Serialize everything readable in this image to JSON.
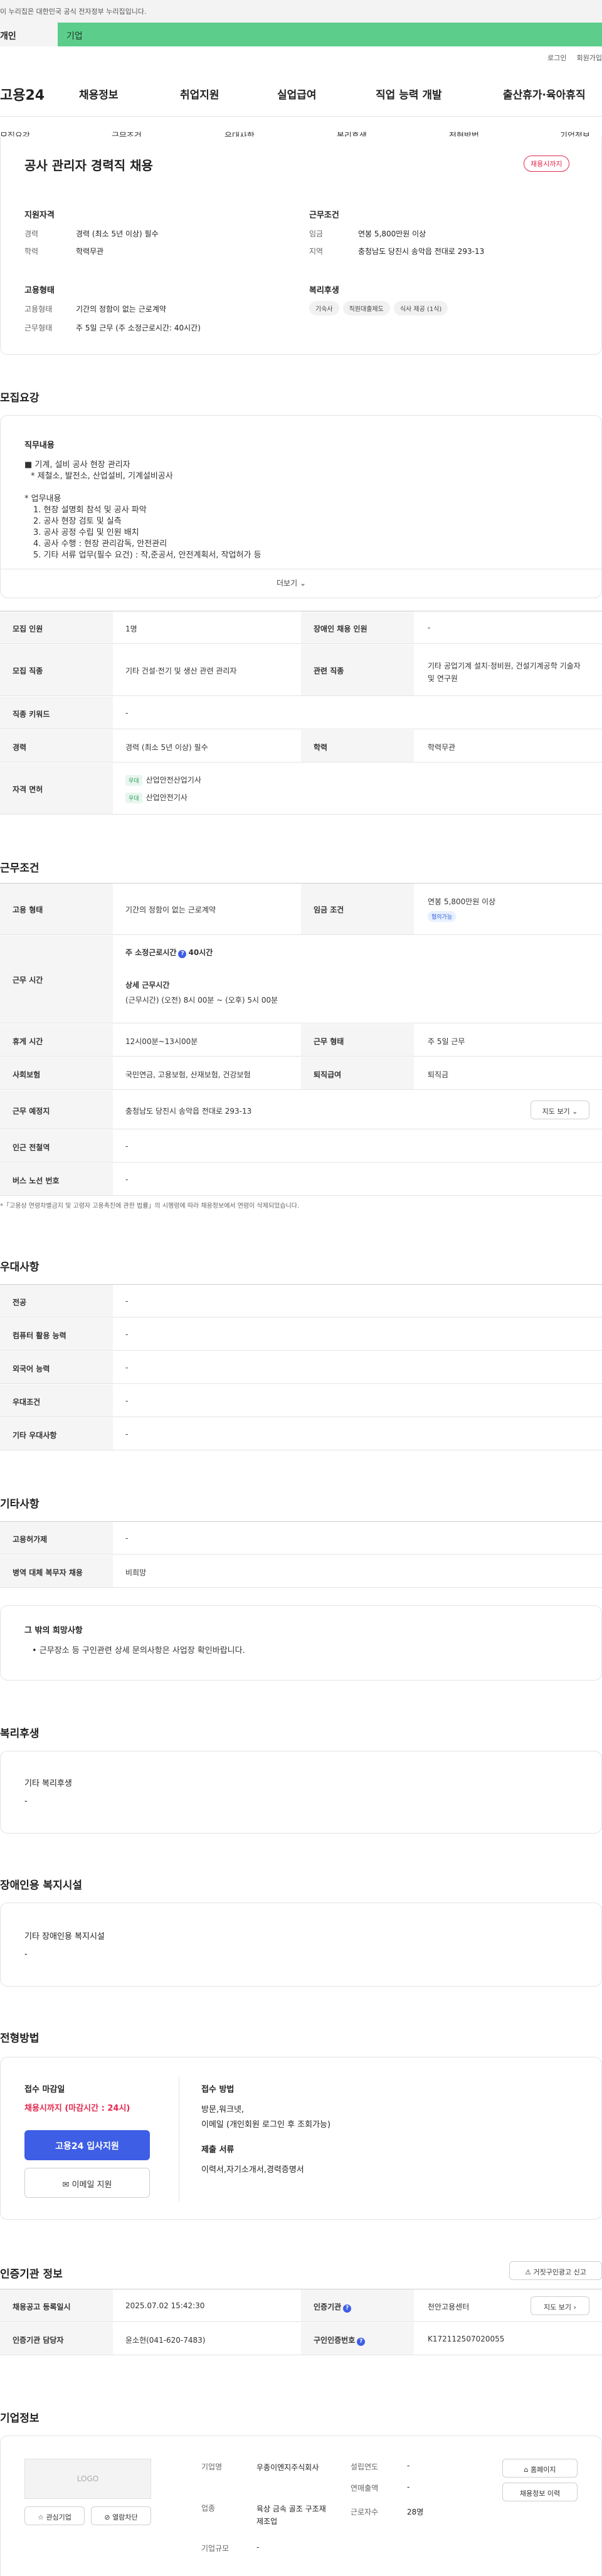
{
  "notice": "이 누리집은 대한민국 공식 전자정부 누리집입니다.",
  "tabs": {
    "personal": "개인",
    "company": "기업"
  },
  "util": {
    "login": "로그인",
    "join": "회원가입"
  },
  "brand": "고용24",
  "nav": [
    "채용정보",
    "취업지원",
    "실업급여",
    "직업 능력 개발",
    "출산휴가·육아휴직"
  ],
  "subnav": [
    "모집요강",
    "근무조건",
    "우대사항",
    "복리후생",
    "전형방법",
    "기업정보"
  ],
  "summary": {
    "title": "공사 관리자 경력직 채용",
    "badge": "채용시까지",
    "qual": {
      "title": "지원자격",
      "career_label": "경력",
      "career_value": "경력 (최소 5년 이상) 필수",
      "edu_label": "학력",
      "edu_value": "학력무관"
    },
    "work": {
      "title": "근무조건",
      "wage_label": "임금",
      "wage_value": "연봉 5,800만원 이상",
      "loc_label": "지역",
      "loc_value": "충청남도 당진시 송악읍 전대로 293-13"
    },
    "employ": {
      "title": "고용형태",
      "type_label": "고용형태",
      "type_value": "기간의 정함이 없는 근로계약",
      "shift_label": "근무형태",
      "shift_value": "주 5일 근무 (주 소정근로시간: 40시간)"
    },
    "welfare": {
      "title": "복리후생",
      "chips": [
        "기숙사",
        "직원대출제도",
        "식사 제공 (1식)"
      ]
    }
  },
  "recruit": {
    "section": "모집요강",
    "duty_title": "직무내용",
    "lines": [
      "■ 기계, 설비 공사 현장 관리자",
      "* 제철소, 발전소, 산업설비, 기계설비공사",
      "",
      "* 업무내용",
      "  1. 현장 설명회 참석 및 공사 파악",
      "  2. 공사 현장 검토 및 실측",
      "  3. 공사 공정 수립 및 인원 배치",
      "  4. 공사 수행 : 현장 관리감독, 안전관리",
      "  5. 기타 서류 업무(필수 요건) : 작,준공서, 안전계획서, 작업허가 등"
    ],
    "more": "더보기",
    "rows": {
      "count_label": "모집 인원",
      "count_value": "1명",
      "disabled_label": "장애인 채용 인원",
      "disabled_value": "-",
      "job_label": "모집 직종",
      "job_value": "기타 건설·전기 및 생산 관련 관리자",
      "related_label": "관련 직종",
      "related_value": "기타 공업기계 설치·정비원, 건설기계공학 기술자 및 연구원",
      "keyword_label": "직종 키워드",
      "keyword_value": "-",
      "career_label": "경력",
      "career_value": "경력 (최소 5년 이상) 필수",
      "edu_label": "학력",
      "edu_value": "학력무관",
      "license_label": "자격 면허",
      "license_badge": "우대",
      "licenses": [
        "산업안전산업기사",
        "산업안전기사"
      ]
    }
  },
  "condition": {
    "section": "근무조건",
    "employ_label": "고용 형태",
    "employ_value": "기간의 정함이 없는 근로계약",
    "wage_label": "임금 조건",
    "wage_value": "연봉 5,800만원 이상",
    "wage_badge": "협의가능",
    "hours_label": "근무 시간",
    "hours_main": "주 소정근로시간",
    "hours_num": "40시간",
    "hours_detail_title": "상세 근무시간",
    "hours_detail": "(근무시간) (오전) 8시 00분 ~ (오후) 5시 00분",
    "break_label": "휴게 시간",
    "break_value": "12시00분~13시00분",
    "shift_label": "근무 형태",
    "shift_value": "주 5일 근무",
    "insurance_label": "사회보험",
    "insurance_value": "국민연금, 고용보험, 산재보험, 건강보험",
    "retire_label": "퇴직급여",
    "retire_value": "퇴직금",
    "place_label": "근무 예정지",
    "place_value": "충청남도 당진시 송악읍 전대로 293-13",
    "map_btn": "지도 보기",
    "station_label": "인근 전철역",
    "station_value": "-",
    "bus_label": "버스 노선 번호",
    "bus_value": "-",
    "footnote": "*「고용상 연령차별금지 및 고령자 고용촉진에 관한 법률」의 시행령에 따라 채용정보에서 연령이 삭제되었습니다."
  },
  "pref": {
    "section": "우대사항",
    "rows": [
      [
        "전공",
        "-"
      ],
      [
        "컴퓨터 활용 능력",
        "-"
      ],
      [
        "외국어 능력",
        "-"
      ],
      [
        "우대조건",
        "-"
      ],
      [
        "기타 우대사항",
        "-"
      ]
    ]
  },
  "etc": {
    "section": "기타사항",
    "rows": [
      [
        "고용허가제",
        "-"
      ],
      [
        "병역 대체 복무자 채용",
        "비희망"
      ]
    ],
    "box_title": "그 밖의 희망사항",
    "box_text": "• 근무장소 등 구인관련 상세 문의사항은 사업장 확인바랍니다."
  },
  "benefit": {
    "section": "복리후생",
    "title": "기타 복리후생",
    "value": "-"
  },
  "disabled": {
    "section": "장애인용 복지시설",
    "title": "기타 장애인용 복지시설",
    "value": "-"
  },
  "process": {
    "section": "전형방법",
    "deadline_label": "접수 마감일",
    "deadline_value": "채용시까지 (마감시간 : 24시)",
    "apply_btn": "고용24 입사지원",
    "email_btn": "이메일 지원",
    "method_label": "접수 방법",
    "method_value1": "방문,워크넷,",
    "method_value2": "이메일 (개인회원 로그인 후 조회가능)",
    "docs_label": "제출 서류",
    "docs_value": "이력서,자기소개서,경력증명서"
  },
  "cert": {
    "section": "인증기관 정보",
    "report_btn": "거짓구인광고 신고",
    "reg_label": "채용공고 등록일시",
    "reg_value": "2025.07.02 15:42:30",
    "agency_label": "인증기관",
    "agency_value": "천안고용센터",
    "map_btn": "지도 보기",
    "manager_label": "인증기관 담당자",
    "manager_value": "윤소현(041-620-7483)",
    "number_label": "구인인증번호",
    "number_value": "K172112507020055"
  },
  "company": {
    "section": "기업정보",
    "logo": "LOGO",
    "interest_btn": "관심기업",
    "block_btn": "열람차단",
    "name_label": "기업명",
    "name_value": "우종이엔지주식회사",
    "industry_label": "업종",
    "industry_value": "육상 금속 골조 구조재 제조업",
    "size_label": "기업규모",
    "size_value": "-",
    "founded_label": "설립연도",
    "founded_value": "-",
    "sales_label": "연매출액",
    "sales_value": "-",
    "staff_label": "근로자수",
    "staff_value": "28명",
    "home_btn": "홈페이지",
    "jobs_btn": "채용정보 이력"
  }
}
